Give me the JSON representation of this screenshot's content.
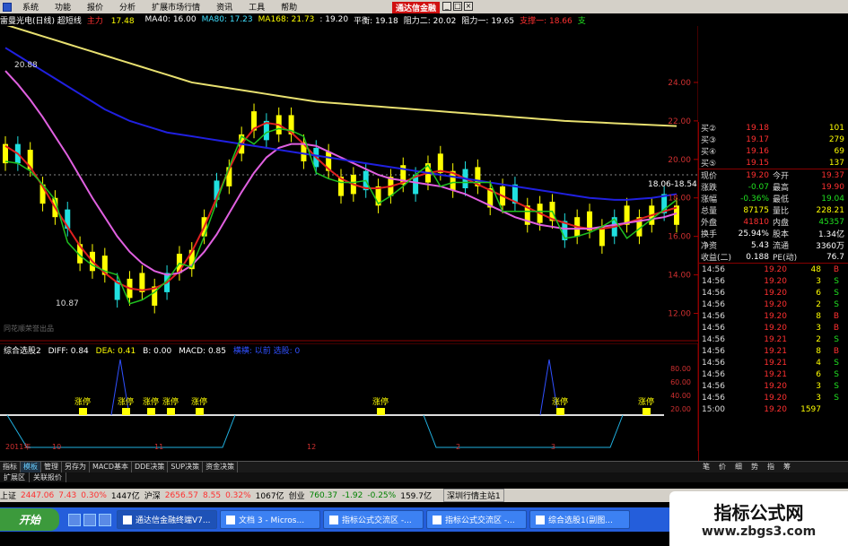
{
  "menu": {
    "items": [
      "系统",
      "功能",
      "报价",
      "分析",
      "扩展市场行情",
      "资讯",
      "工具",
      "帮助"
    ],
    "brand": "通达信金融"
  },
  "infobar": {
    "stock": "雷曼光电(日线) 超短线",
    "main_label": "主力",
    "main_val": "17.48",
    "ma40": "MA40: 16.00",
    "ma80": "MA80: 17.23",
    "ma168": "MA168: 21.73",
    "v1": ": 19.20",
    "pingheng": "平衡: 19.18",
    "zuli2": "阻力二: 20.02",
    "zuli1": "阻力一: 19.65",
    "zhicheng1": "支撑一: 18.66",
    "end": "支"
  },
  "chart_labels": {
    "high_mark": "20.88",
    "low_mark": "10.87",
    "right_mark": "18.06-18.54",
    "watermark_text": "同花顺荣誉出品",
    "y_ticks": [
      "24.00",
      "22.00",
      "20.00",
      "18.00",
      "16.00",
      "14.00",
      "12.00"
    ],
    "sub_ticks": [
      "80.00",
      "60.00",
      "40.00",
      "20.00"
    ],
    "x_ticks": [
      "2011年",
      "10",
      "11",
      "12",
      "2",
      "3"
    ],
    "zhangting": "涨停"
  },
  "sub_chart": {
    "name": "综合选股2",
    "diff": "DIFF: 0.84",
    "dea": "DEA: 0.41",
    "b": "B: 0.00",
    "macd": "MACD: 0.85",
    "extra": "横横: 以前 选股: 0"
  },
  "quotes": {
    "buys": [
      {
        "label": "买②",
        "price": "19.18",
        "vol": "101"
      },
      {
        "label": "买③",
        "price": "19.17",
        "vol": "279"
      },
      {
        "label": "买④",
        "price": "19.16",
        "vol": "69"
      },
      {
        "label": "买⑤",
        "price": "19.15",
        "vol": "137"
      }
    ],
    "stats": [
      {
        "l1": "现价",
        "v1": "19.20",
        "c1": "red",
        "l2": "今开",
        "v2": "19.37",
        "c2": "red"
      },
      {
        "l1": "涨跌",
        "v1": "-0.07",
        "c1": "green",
        "l2": "最高",
        "v2": "19.90",
        "c2": "red"
      },
      {
        "l1": "涨幅",
        "v1": "-0.36%",
        "c1": "green",
        "l2": "最低",
        "v2": "19.04",
        "c2": "green"
      },
      {
        "l1": "总量",
        "v1": "87175",
        "c1": "yellow",
        "l2": "量比",
        "v2": "228.21",
        "c2": "yellow"
      },
      {
        "l1": "外盘",
        "v1": "41810",
        "c1": "red",
        "l2": "内盘",
        "v2": "45357",
        "c2": "green"
      },
      {
        "l1": "换手",
        "v1": "25.94%",
        "c1": "white",
        "l2": "股本",
        "v2": "1.34亿",
        "c2": "white"
      },
      {
        "l1": "净资",
        "v1": "5.43",
        "c1": "white",
        "l2": "流通",
        "v2": "3360万",
        "c2": "white"
      },
      {
        "l1": "收益(二)",
        "v1": "0.188",
        "c1": "white",
        "l2": "PE(动)",
        "v2": "76.7",
        "c2": "white"
      }
    ],
    "ticks": [
      {
        "t": "14:56",
        "p": "19.20",
        "v": "48",
        "d": "B",
        "dc": "red"
      },
      {
        "t": "14:56",
        "p": "19.20",
        "v": "3",
        "d": "S",
        "dc": "green"
      },
      {
        "t": "14:56",
        "p": "19.20",
        "v": "6",
        "d": "S",
        "dc": "green"
      },
      {
        "t": "14:56",
        "p": "19.20",
        "v": "2",
        "d": "S",
        "dc": "green"
      },
      {
        "t": "14:56",
        "p": "19.20",
        "v": "8",
        "d": "B",
        "dc": "red"
      },
      {
        "t": "14:56",
        "p": "19.20",
        "v": "3",
        "d": "B",
        "dc": "red"
      },
      {
        "t": "14:56",
        "p": "19.21",
        "v": "2",
        "d": "S",
        "dc": "green"
      },
      {
        "t": "14:56",
        "p": "19.21",
        "v": "8",
        "d": "B",
        "dc": "red"
      },
      {
        "t": "14:56",
        "p": "19.21",
        "v": "4",
        "d": "S",
        "dc": "green"
      },
      {
        "t": "14:56",
        "p": "19.21",
        "v": "6",
        "d": "S",
        "dc": "green"
      },
      {
        "t": "14:56",
        "p": "19.20",
        "v": "3",
        "d": "S",
        "dc": "green"
      },
      {
        "t": "14:56",
        "p": "19.20",
        "v": "3",
        "d": "S",
        "dc": "green"
      },
      {
        "t": "15:00",
        "p": "19.20",
        "v": "1597",
        "d": "",
        "dc": "white"
      }
    ]
  },
  "tabs": [
    "指标",
    "模板",
    "管理",
    "另存为",
    "MACD基本",
    "DDE决策",
    "SUP决策",
    "资金决策"
  ],
  "sidetabs": [
    "笔",
    "价",
    "细",
    "势",
    "指",
    "筹"
  ],
  "extbar": [
    "扩展区",
    "关联报价"
  ],
  "sidebar_title": "日线",
  "statusbar": {
    "sh_label": "上证",
    "sh_val": "2447.06",
    "sh_chg": "7.43",
    "sh_pct": "0.30%",
    "sh_amt": "1447亿",
    "hs_label": "沪深",
    "hs_val": "2656.57",
    "hs_chg": "8.55",
    "hs_pct": "0.32%",
    "hs_amt": "1067亿",
    "cy_label": "创业",
    "cy_val": "760.37",
    "cy_chg": "-1.92",
    "cy_pct": "-0.25%",
    "cy_amt": "159.7亿",
    "info": "深圳行情主站1"
  },
  "taskbar": {
    "start": "开始",
    "buttons": [
      "通达信金融终端V7...",
      "文档 3 - Micros...",
      "指标公式交流区 -...",
      "指标公式交流区 -...",
      "综合选股1(副图..."
    ]
  },
  "watermark": {
    "line1": "指标公式网",
    "line2": "www.zbgs3.com"
  },
  "colors": {
    "up": "#ff3030",
    "down": "#20e0e0",
    "ma_yellow": "#e8e070",
    "ma_blue": "#2020e0",
    "ma_magenta": "#e060e0",
    "ma_red": "#e02020",
    "ma_green": "#20c020"
  },
  "chart_data": {
    "type": "line",
    "ylim": [
      11,
      26
    ],
    "series": [
      {
        "name": "主力",
        "values": [
          20.7,
          20.3,
          19.6,
          18.6,
          17.5,
          16.5,
          15.5,
          14.7,
          14.1,
          13.6,
          13.3,
          13.2,
          13.3,
          13.6,
          14.2,
          15.2,
          16.5,
          18.0,
          19.5,
          20.8,
          21.6,
          21.9,
          21.8,
          21.4,
          20.8,
          20.1,
          19.5,
          19.0,
          18.7,
          18.5,
          18.5,
          18.6,
          18.8,
          19.1,
          19.3,
          19.4,
          19.3,
          19.0,
          18.7,
          18.4,
          18.1,
          17.8,
          17.5,
          17.2,
          16.9,
          16.7,
          16.5,
          16.4,
          16.4,
          16.5,
          16.7,
          16.9,
          17.1,
          17.3,
          17.5
        ]
      },
      {
        "name": "MA40",
        "values": [
          24.6,
          23.9,
          23.1,
          22.2,
          21.2,
          20.2,
          19.1,
          18.0,
          17.0,
          16.0,
          15.2,
          14.6,
          14.2,
          14.0,
          14.1,
          14.5,
          15.2,
          16.1,
          17.2,
          18.3,
          19.3,
          20.1,
          20.6,
          20.8,
          20.8,
          20.7,
          20.4,
          20.1,
          19.8,
          19.5,
          19.2,
          19.0,
          18.9,
          18.8,
          18.7,
          18.6,
          18.4,
          18.2,
          17.9,
          17.6,
          17.3,
          17.0,
          16.8,
          16.6,
          16.5,
          16.4,
          16.4,
          16.4,
          16.5,
          16.6,
          16.7,
          16.8,
          16.9,
          17.0,
          17.2
        ]
      },
      {
        "name": "MA80",
        "values": [
          25.8,
          25.4,
          25.0,
          24.6,
          24.2,
          23.8,
          23.4,
          23.0,
          22.6,
          22.3,
          22.0,
          21.8,
          21.6,
          21.4,
          21.3,
          21.2,
          21.1,
          21.0,
          20.9,
          20.8,
          20.7,
          20.6,
          20.5,
          20.4,
          20.3,
          20.2,
          20.1,
          20.0,
          19.9,
          19.8,
          19.7,
          19.6,
          19.5,
          19.4,
          19.3,
          19.2,
          19.1,
          19.0,
          18.9,
          18.8,
          18.7,
          18.6,
          18.5,
          18.4,
          18.3,
          18.2,
          18.1,
          18.0,
          17.95,
          17.9,
          17.9,
          17.95,
          18.0,
          18.1,
          18.2
        ]
      },
      {
        "name": "MA168",
        "values": [
          27.0,
          26.8,
          26.6,
          26.4,
          26.2,
          26.0,
          25.8,
          25.6,
          25.4,
          25.2,
          25.0,
          24.8,
          24.6,
          24.4,
          24.2,
          24.0,
          23.9,
          23.8,
          23.7,
          23.6,
          23.5,
          23.4,
          23.3,
          23.2,
          23.1,
          23.0,
          22.95,
          22.9,
          22.85,
          22.8,
          22.75,
          22.7,
          22.65,
          22.6,
          22.55,
          22.5,
          22.45,
          22.4,
          22.35,
          22.3,
          22.25,
          22.2,
          22.15,
          22.1,
          22.05,
          22.0,
          21.97,
          21.94,
          21.91,
          21.88,
          21.85,
          21.82,
          21.79,
          21.76,
          21.73
        ]
      }
    ]
  }
}
